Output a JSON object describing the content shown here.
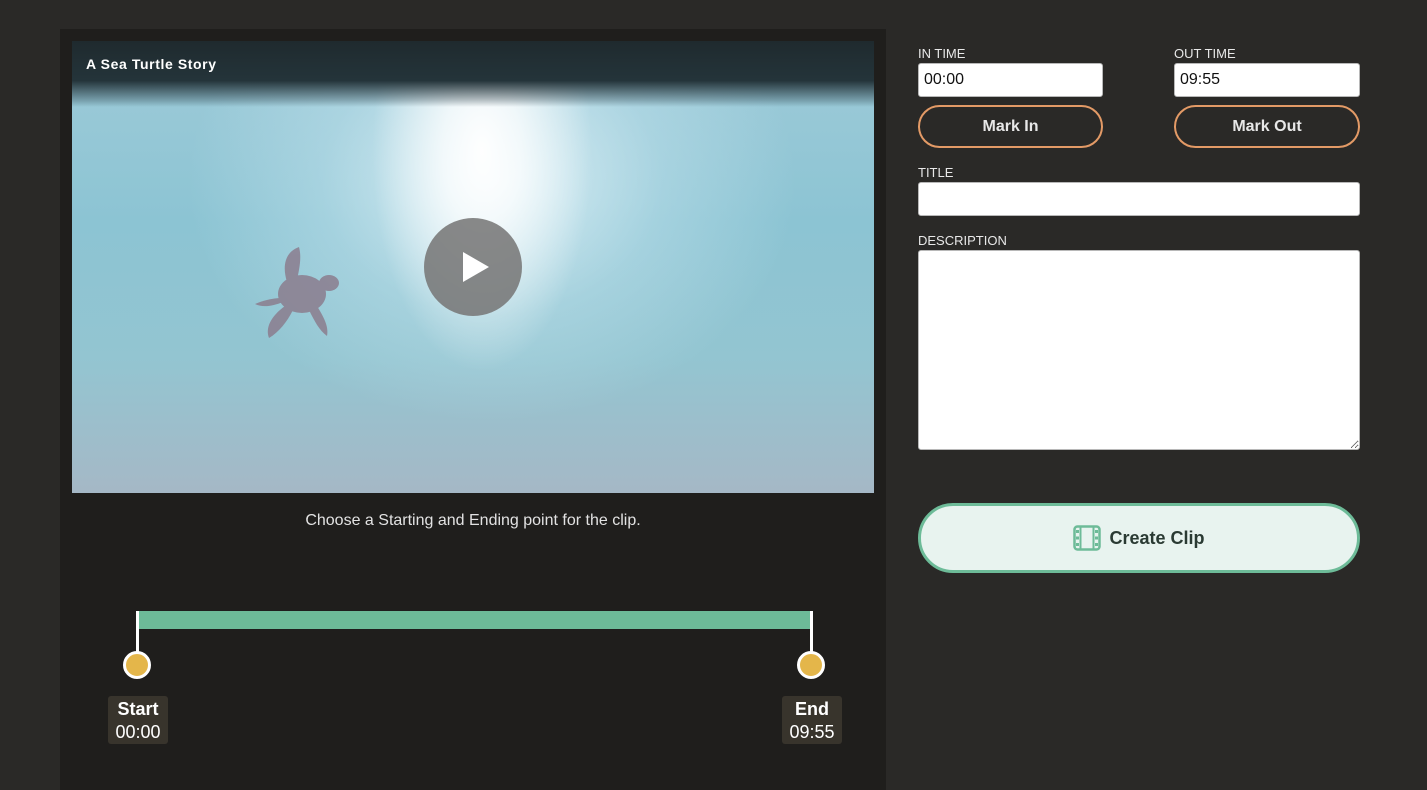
{
  "video": {
    "title": "A Sea Turtle Story"
  },
  "hint_text": "Choose a Starting and Ending point for the clip.",
  "range": {
    "start_fraction": 0.0,
    "end_fraction": 1.0,
    "start_label": "Start",
    "start_time": "00:00",
    "end_label": "End",
    "end_time": "09:55"
  },
  "form": {
    "in_time_label": "IN TIME",
    "in_time_value": "00:00",
    "out_time_label": "OUT TIME",
    "out_time_value": "09:55",
    "mark_in_label": "Mark In",
    "mark_out_label": "Mark Out",
    "title_label": "TITLE",
    "title_value": "",
    "description_label": "DESCRIPTION",
    "description_value": "",
    "create_clip_label": "Create Clip"
  },
  "colors": {
    "accent_green": "#6dbb98",
    "accent_orange": "#e39a66",
    "knob_yellow": "#e4b64a"
  },
  "icons": {
    "play": "play-icon",
    "create_clip": "film-icon"
  }
}
